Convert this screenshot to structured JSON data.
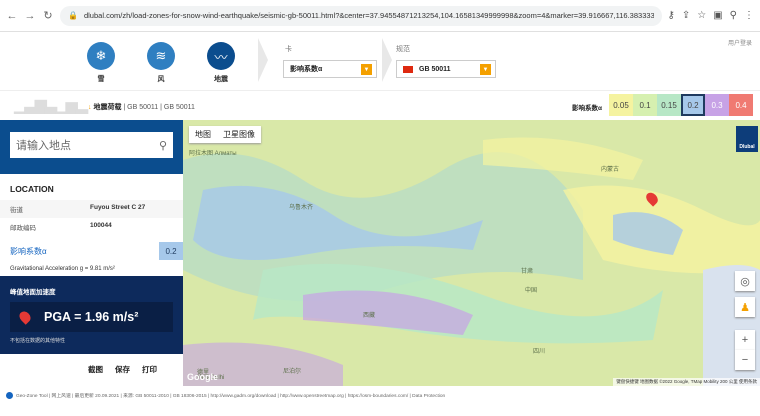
{
  "browser": {
    "url": "dlubal.com/zh/load-zones-for-snow-wind-earthquake/seismic-gb-50011.html?&center=37.94554871213254,104.16581349999998&zoom=4&marker=39.916667,116.383333#&center=37.28..."
  },
  "header": {
    "hazards": [
      {
        "label": "雪",
        "icon": "snowflake-icon"
      },
      {
        "label": "风",
        "icon": "wind-icon"
      },
      {
        "label": "地震",
        "icon": "seismic-icon"
      }
    ],
    "card_label": "卡",
    "card_value": "影响系数α",
    "standard_label": "规范",
    "standard_value": "GB 50011",
    "login": "用户登录"
  },
  "strip": {
    "breadcrumb_current": "地震荷载",
    "breadcrumb_rest": "| GB 50011 | GB 50011",
    "legend_label": "影响系数α",
    "legend": [
      {
        "value": "0.05",
        "color": "#f5f3a0"
      },
      {
        "value": "0.1",
        "color": "#d6f0b0"
      },
      {
        "value": "0.15",
        "color": "#b7e7c6"
      },
      {
        "value": "0.2",
        "color": "#a6c8ea"
      },
      {
        "value": "0.3",
        "color": "#c7a2e6"
      },
      {
        "value": "0.4",
        "color": "#f07a72"
      }
    ]
  },
  "panel": {
    "search_placeholder": "请输入地点",
    "location_title": "LOCATION",
    "street_label": "街道",
    "street_value": "Fuyou Street C 27",
    "postal_label": "邮政编码",
    "postal_value": "100044",
    "coef_label": "影响系数α",
    "coef_value": "0.2",
    "gravity": "Gravitational Acceleration g = 9.81 m/s²",
    "pga_title": "峰值地面加速度",
    "pga_value": "PGA = 1.96 m/s²",
    "pga_note": "不包括在数据的其他特性",
    "actions": [
      "截图",
      "保存",
      "打印"
    ]
  },
  "map": {
    "tabs": [
      "地图",
      "卫星图像"
    ],
    "labels": [
      "阿拉木图 Алматы",
      "乌鲁木齐",
      "内蒙古",
      "甘肃",
      "中国",
      "西藏",
      "四川",
      "德里",
      "New Delhi",
      "尼泊尔"
    ],
    "attribution": "键盘快捷键  地图数据 ©2022 Google, TMap Mobility  200 公里  使用条款",
    "google": "Google"
  },
  "footer": {
    "text": "Geo-Zone Tool | 网上风速 | 最后更新 20.09.2021 | 来源: GB 50011-2010 | GB 18306-2015 | http://www.gadm.org/download | http://www.openstreetmap.org | https://osm-boundaries.com/ | Data Protection"
  }
}
